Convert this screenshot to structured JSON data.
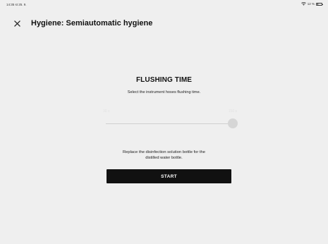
{
  "status_bar": {
    "time": "14:35  st 25. 9.",
    "battery_text": "12 %",
    "battery_level": 0.12,
    "icons": [
      "wifi-icon",
      "battery-icon"
    ]
  },
  "header": {
    "close_icon": "close-icon",
    "title": "Hygiene: Semiautomatic hygiene"
  },
  "flushing": {
    "title": "FLUSHING TIME",
    "subtitle": "Select the instrument hoses flushing time.",
    "slider": {
      "min_label": "30 s",
      "max_label": "150 s",
      "value_fraction": 1.0,
      "disabled": true
    }
  },
  "instruction": {
    "line1": "Replace the disinfection solution bottle for the",
    "line2": "distilled water bottle."
  },
  "start_button": {
    "label": "START"
  },
  "colors": {
    "background": "#efefef",
    "button": "#111111",
    "button_text": "#ffffff",
    "slider_disabled": "#d6d6d6"
  }
}
